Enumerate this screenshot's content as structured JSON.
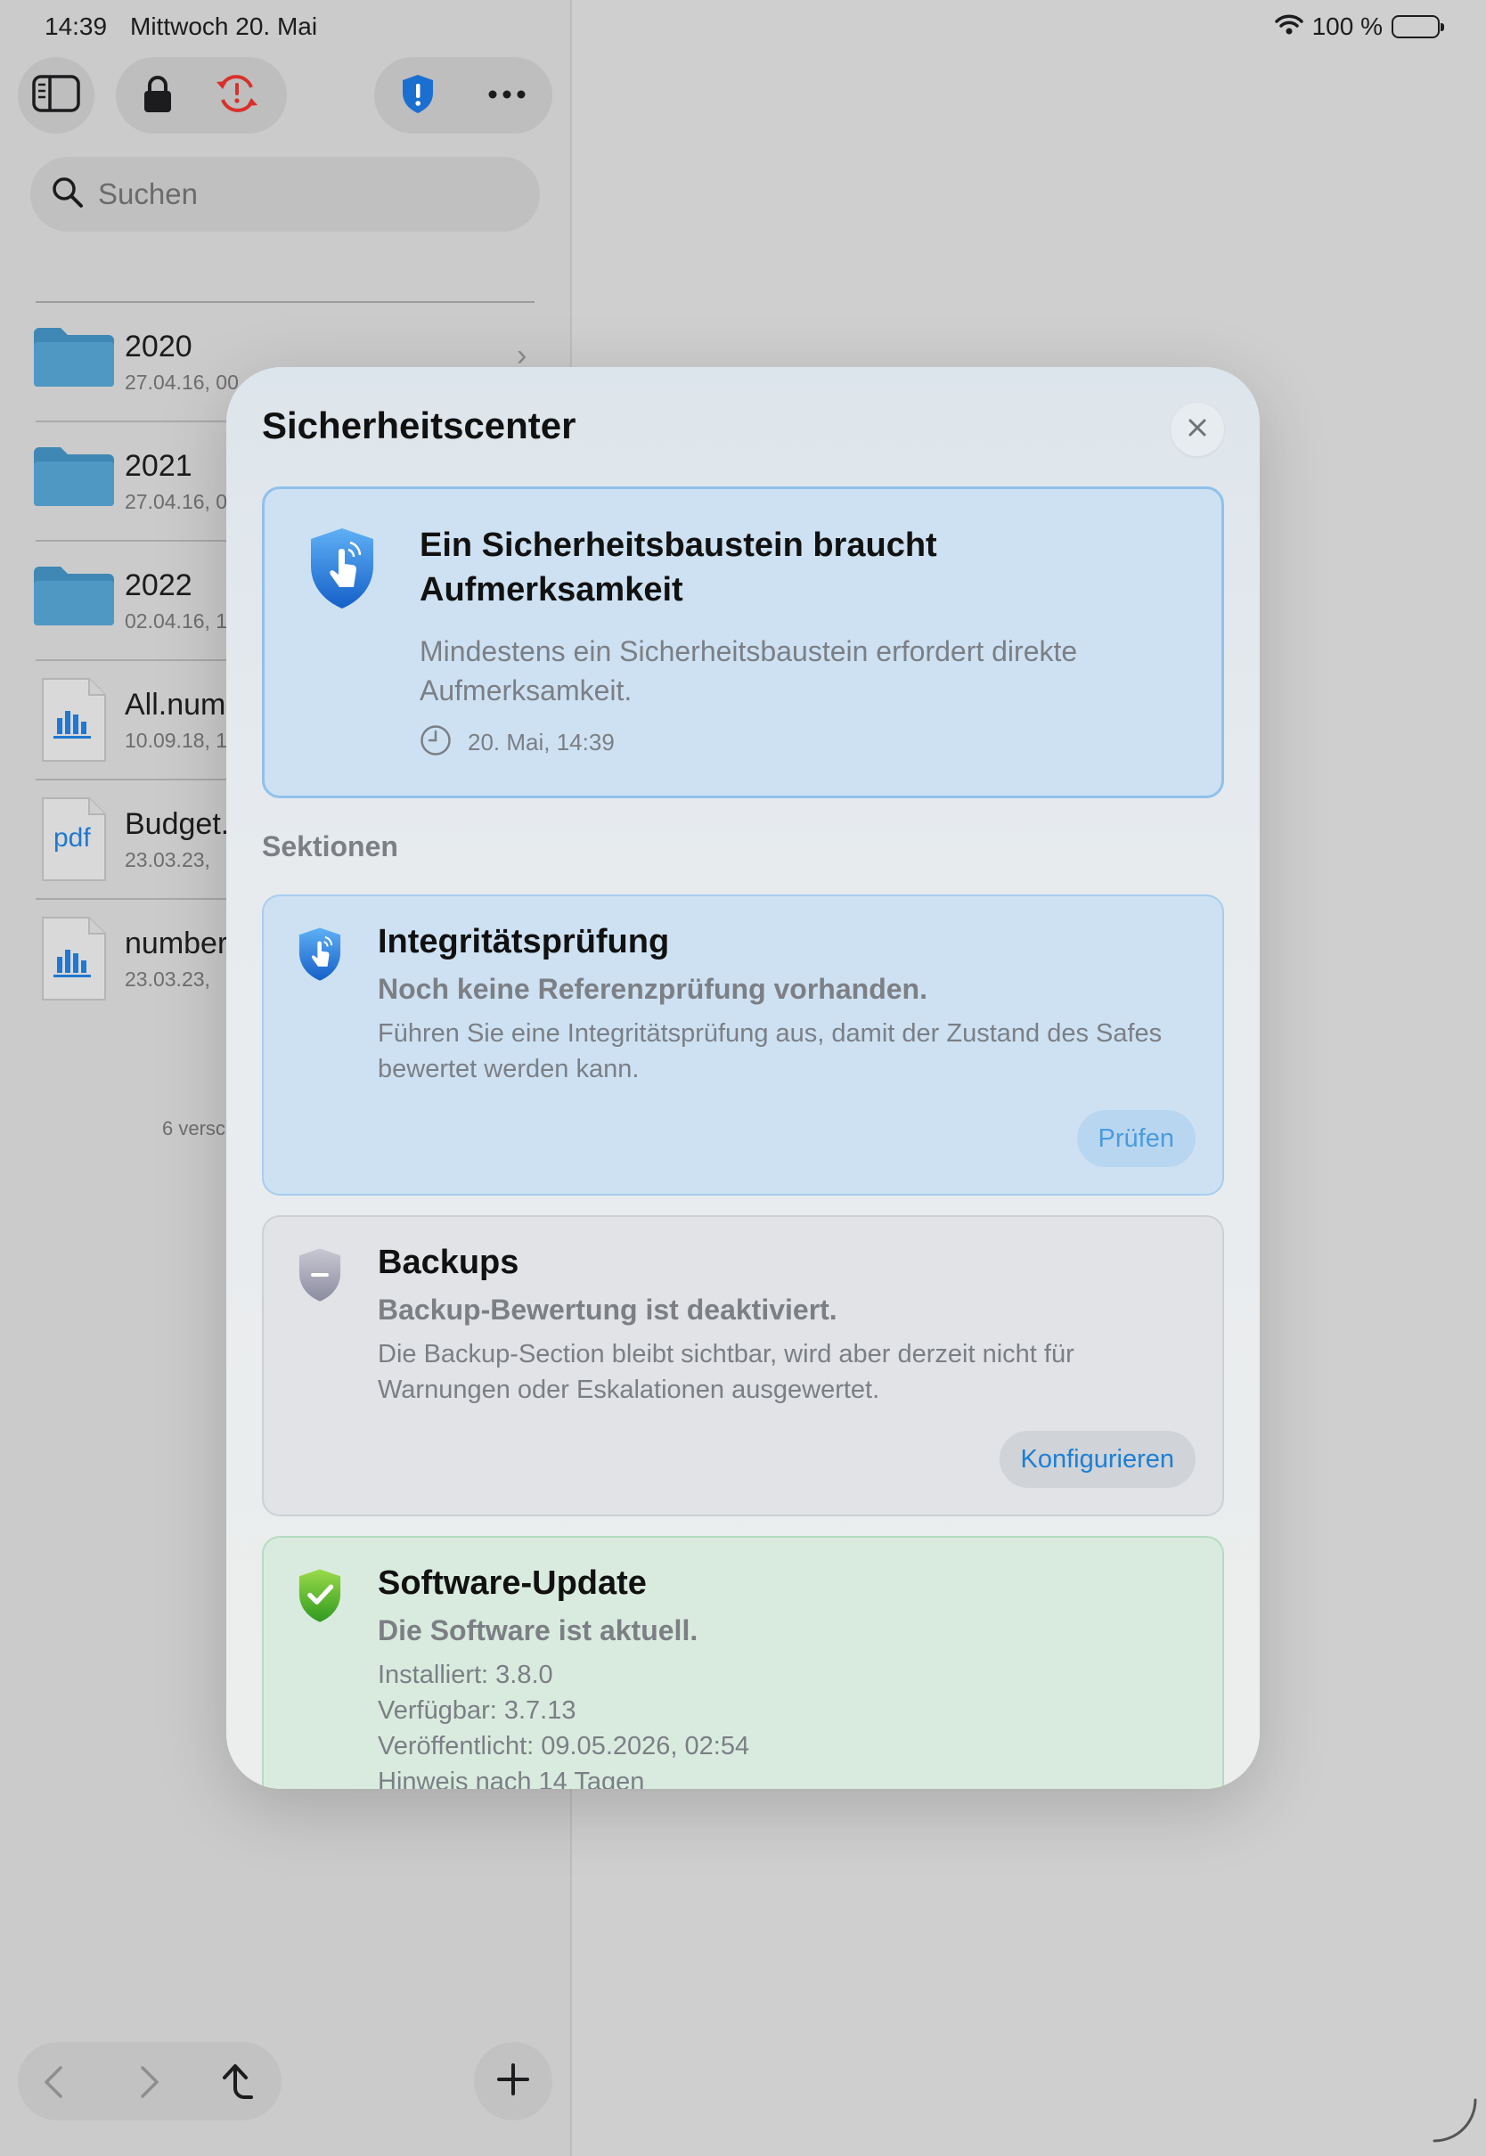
{
  "status_bar": {
    "time": "14:39",
    "date": "Mittwoch 20. Mai",
    "battery": "100 %"
  },
  "sidebar": {
    "search_placeholder": "Suchen",
    "files": [
      {
        "name": "2020",
        "meta": "27.04.16, 00",
        "type": "folder"
      },
      {
        "name": "2021",
        "meta": "27.04.16, 0",
        "type": "folder"
      },
      {
        "name": "2022",
        "meta": "02.04.16, 1",
        "type": "folder"
      },
      {
        "name": "All.num",
        "meta": "10.09.18, 1",
        "type": "numbers"
      },
      {
        "name": "Budget.",
        "meta": "23.03.23,",
        "type": "pdf"
      },
      {
        "name": "number",
        "meta": "23.03.23,",
        "type": "numbers"
      }
    ],
    "pdf_label": "pdf",
    "file_count": "6 versc"
  },
  "modal": {
    "title": "Sicherheitscenter",
    "alert": {
      "title": "Ein Sicherheitsbaustein braucht Aufmerksamkeit",
      "description": "Mindestens ein Sicherheitsbaustein erfordert direkte Aufmerksamkeit.",
      "timestamp": "20. Mai, 14:39"
    },
    "sections_label": "Sektionen",
    "sections": [
      {
        "title": "Integritätsprüfung",
        "status": "Noch keine Referenzprüfung vorhanden.",
        "description": "Führen Sie eine Integritätsprüfung aus, damit der Zustand des Safes bewertet werden kann.",
        "action": "Prüfen"
      },
      {
        "title": "Backups",
        "status": "Backup-Bewertung ist deaktiviert.",
        "description": "Die Backup-Section bleibt sichtbar, wird aber derzeit nicht für Warnungen oder Eskalationen ausgewertet.",
        "action": "Konfigurieren"
      },
      {
        "title": "Software-Update",
        "status": "Die Software ist aktuell.",
        "lines": [
          "Installiert: 3.8.0",
          "Verfügbar: 3.7.13",
          "Veröffentlicht: 09.05.2026, 02:54",
          "Hinweis nach 14 Tagen"
        ]
      }
    ]
  },
  "colors": {
    "accent_blue": "#1b7fd6",
    "folder_blue": "#4a8fb8",
    "sync_red": "#d9302c",
    "ok_green": "#43b02a"
  }
}
